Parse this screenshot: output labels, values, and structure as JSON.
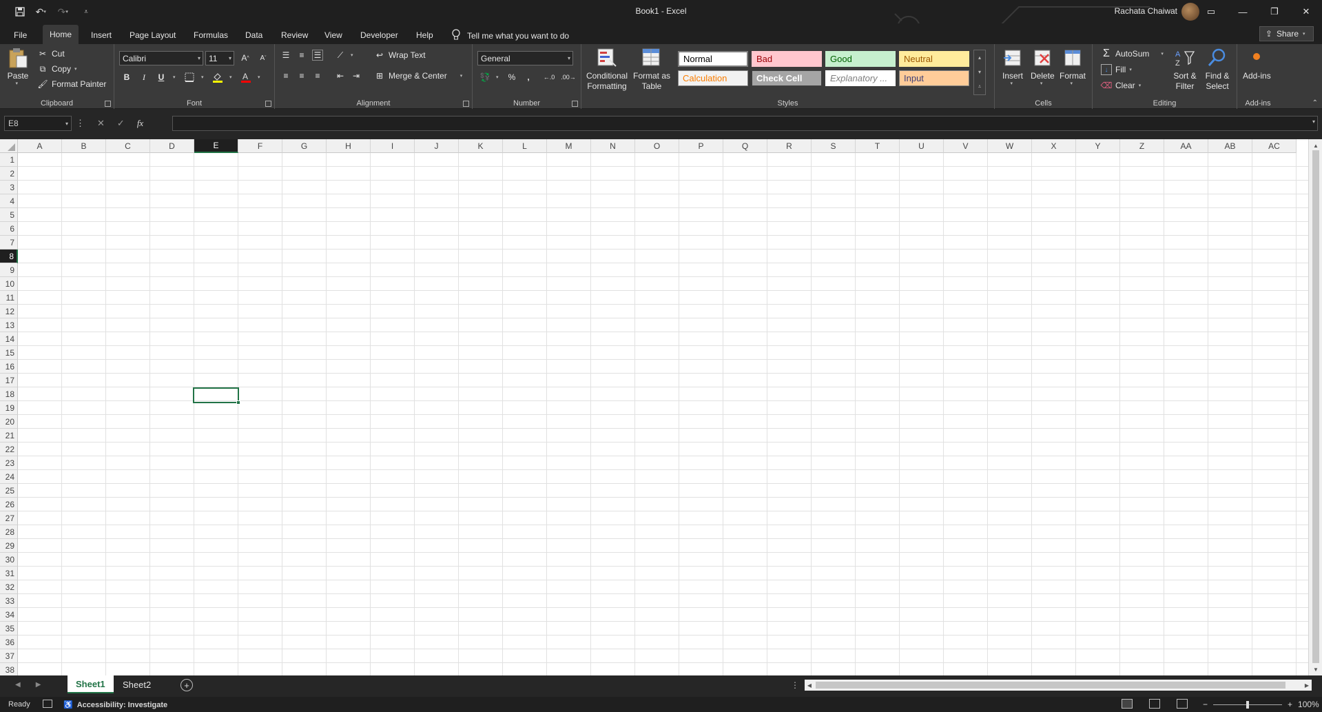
{
  "window": {
    "title": "Book1  -  Excel",
    "user": "Rachata Chaiwat"
  },
  "tabs": [
    {
      "label": "File"
    },
    {
      "label": "Home"
    },
    {
      "label": "Insert"
    },
    {
      "label": "Page Layout"
    },
    {
      "label": "Formulas"
    },
    {
      "label": "Data"
    },
    {
      "label": "Review"
    },
    {
      "label": "View"
    },
    {
      "label": "Developer"
    },
    {
      "label": "Help"
    }
  ],
  "tellme": "Tell me what you want to do",
  "share": "Share",
  "clipboard": {
    "paste": "Paste",
    "cut": "Cut",
    "copy": "Copy",
    "format_painter": "Format Painter",
    "label": "Clipboard"
  },
  "font": {
    "name": "Calibri",
    "size": "11",
    "label": "Font",
    "bold": "B",
    "italic": "I",
    "underline": "U"
  },
  "alignment": {
    "wrap": "Wrap Text",
    "merge": "Merge & Center",
    "label": "Alignment"
  },
  "number": {
    "format": "General",
    "label": "Number",
    "percent": "%",
    "comma": ","
  },
  "styles": {
    "conditional": "Conditional Formatting",
    "format_table": "Format as Table",
    "cells": [
      {
        "label": "Normal",
        "bg": "#ffffff",
        "fg": "#000000",
        "border": "#7f7f7f"
      },
      {
        "label": "Bad",
        "bg": "#ffc7ce",
        "fg": "#9c0006",
        "border": "#ffc7ce"
      },
      {
        "label": "Good",
        "bg": "#c6efce",
        "fg": "#006100",
        "border": "#c6efce"
      },
      {
        "label": "Neutral",
        "bg": "#ffeb9c",
        "fg": "#9c5700",
        "border": "#ffeb9c"
      },
      {
        "label": "Calculation",
        "bg": "#f2f2f2",
        "fg": "#fa7d00",
        "border": "#7f7f7f"
      },
      {
        "label": "Check Cell",
        "bg": "#a5a5a5",
        "fg": "#ffffff",
        "border": "#3f3f3f"
      },
      {
        "label": "Explanatory ...",
        "bg": "#ffffff",
        "fg": "#7f7f7f",
        "border": "#ffffff"
      },
      {
        "label": "Input",
        "bg": "#ffcc99",
        "fg": "#3f3f76",
        "border": "#7f7f7f"
      }
    ],
    "label": "Styles"
  },
  "cells_group": {
    "insert": "Insert",
    "delete": "Delete",
    "format": "Format",
    "label": "Cells"
  },
  "editing": {
    "autosum": "AutoSum",
    "fill": "Fill",
    "clear": "Clear",
    "sort": "Sort & Filter",
    "find": "Find & Select",
    "label": "Editing"
  },
  "addins": {
    "button": "Add-ins",
    "label": "Add-ins"
  },
  "formula_bar": {
    "namebox": "E8",
    "fx": "fx",
    "formula": ""
  },
  "columns": [
    "A",
    "B",
    "C",
    "D",
    "E",
    "F",
    "G",
    "H",
    "I",
    "J",
    "K",
    "L",
    "M",
    "N",
    "O",
    "P",
    "Q",
    "R",
    "S",
    "T",
    "U",
    "V",
    "W",
    "X",
    "Y",
    "Z",
    "AA",
    "AB",
    "AC"
  ],
  "selected_column": "E",
  "selected_row": 8,
  "row_count": 38,
  "sheets": [
    {
      "label": "Sheet1",
      "active": true
    },
    {
      "label": "Sheet2",
      "active": false
    }
  ],
  "status": {
    "ready": "Ready",
    "accessibility": "Accessibility: Investigate",
    "zoom": "100%"
  },
  "colors": {
    "accent": "#217346"
  }
}
